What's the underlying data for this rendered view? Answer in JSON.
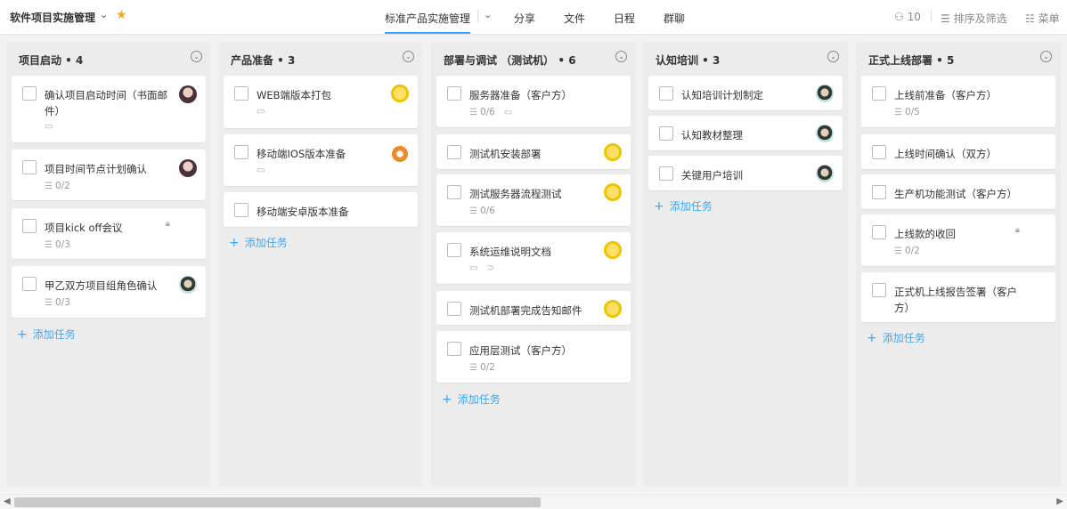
{
  "header": {
    "project_title": "软件项目实施管理",
    "tabs": [
      {
        "label": "标准产品实施管理",
        "active": true
      },
      {
        "label": "分享"
      },
      {
        "label": "文件"
      },
      {
        "label": "日程"
      },
      {
        "label": "群聊"
      }
    ],
    "member_count": "10",
    "sort_filter_label": "排序及筛选",
    "menu_label": "菜单"
  },
  "add_task_label": "添加任务",
  "columns": [
    {
      "title": "项目启动 • 4",
      "cards": [
        {
          "title": "确认项目启动时间（书面邮件）",
          "has_comment": true,
          "avatar": "photo"
        },
        {
          "title": "项目时间节点计划确认",
          "subtasks": "0/2",
          "avatar": "photo"
        },
        {
          "title": "项目kick off会议",
          "subtasks": "0/3",
          "locked": true
        },
        {
          "title": "甲乙双方项目组角色确认",
          "subtasks": "0/3",
          "avatar": "man"
        }
      ]
    },
    {
      "title": "产品准备 • 3",
      "cards": [
        {
          "title": "WEB端版本打包",
          "has_comment": true,
          "avatar": "chick"
        },
        {
          "title": "移动端IOS版本准备",
          "has_comment": true,
          "avatar": "fox"
        },
        {
          "title": "移动端安卓版本准备"
        }
      ]
    },
    {
      "title": "部署与调试 （测试机） • 6",
      "cards": [
        {
          "title": "服务器准备（客户方）",
          "subtasks": "0/6",
          "has_comment": true
        },
        {
          "title": "测试机安装部署",
          "avatar": "chick"
        },
        {
          "title": "测试服务器流程测试",
          "subtasks": "0/6",
          "avatar": "chick"
        },
        {
          "title": "系统运维说明文档",
          "has_comment": true,
          "has_attachment": true,
          "avatar": "chick"
        },
        {
          "title": "测试机部署完成告知邮件",
          "avatar": "chick"
        },
        {
          "title": "应用层测试（客户方）",
          "subtasks": "0/2"
        }
      ]
    },
    {
      "title": "认知培训 • 3",
      "cards": [
        {
          "title": "认知培训计划制定",
          "avatar": "man"
        },
        {
          "title": "认知教材整理",
          "avatar": "man"
        },
        {
          "title": "关键用户培训",
          "avatar": "man"
        }
      ]
    },
    {
      "title": "正式上线部署 • 5",
      "cards": [
        {
          "title": "上线前准备（客户方）",
          "subtasks": "0/5"
        },
        {
          "title": "上线时间确认（双方）"
        },
        {
          "title": "生产机功能测试（客户方）"
        },
        {
          "title": "上线款的收回",
          "subtasks": "0/2",
          "locked": true
        },
        {
          "title": "正式机上线报告签署（客户方）"
        }
      ]
    }
  ]
}
